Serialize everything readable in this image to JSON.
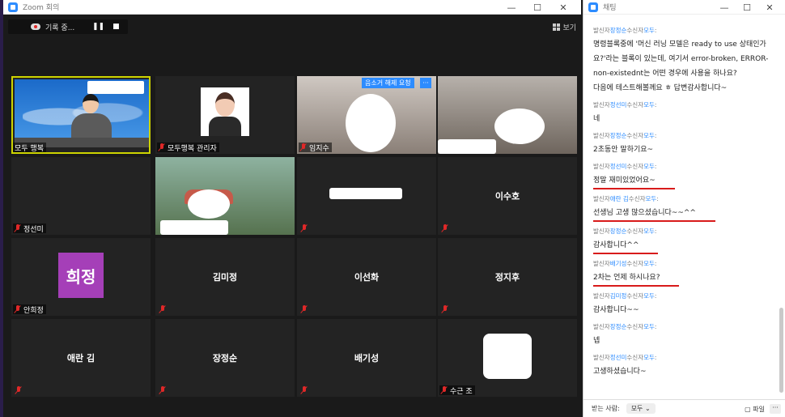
{
  "zoom": {
    "title": "Zoom 회의",
    "recording_text": "기록 중...",
    "pause_glyph": "❚❚",
    "stop_glyph": "■",
    "view_label": "보기",
    "window_controls": [
      "—",
      "☐",
      "✕"
    ]
  },
  "participants": [
    {
      "name": "모두 행복",
      "type": "video"
    },
    {
      "name": "모두행복 관리자",
      "type": "photo"
    },
    {
      "name": "임지수",
      "type": "video",
      "hint": "음소거 해제 요청",
      "more": "···"
    },
    {
      "name": "",
      "type": "video"
    },
    {
      "name": "정선미",
      "type": "dark"
    },
    {
      "name": "",
      "type": "video"
    },
    {
      "name": "",
      "type": "dark"
    },
    {
      "name": "이수호",
      "type": "dark"
    },
    {
      "name": "안희정",
      "type": "avatar",
      "avatar": "희정"
    },
    {
      "name": "김미정",
      "type": "dark"
    },
    {
      "name": "이선화",
      "type": "dark"
    },
    {
      "name": "정지후",
      "type": "dark"
    },
    {
      "name": "애란 김",
      "type": "dark"
    },
    {
      "name": "장정순",
      "type": "dark"
    },
    {
      "name": "배기성",
      "type": "dark"
    },
    {
      "name": "수근 조",
      "type": "dark"
    }
  ],
  "chat": {
    "title": "채팅",
    "window_controls": [
      "—",
      "☐",
      "✕"
    ],
    "messages": [
      {
        "from": "장정순",
        "to": "모두",
        "text": "명령블록중에 '머신 러닝 모델은 ready to use 상태인가요?'라는 블록이 있는데, 여기서 error-broken, ERROR-non-existednt는 어떤 경우에 사용을 하나요?\n다음에 테스트해볼께요 ㅎ 답변감사합니다~"
      },
      {
        "from": "정선미",
        "to": "모두",
        "text": "네"
      },
      {
        "from": "장정순",
        "to": "모두",
        "text": "2초동안 말하기요~"
      },
      {
        "from": "정선미",
        "to": "모두",
        "text": "정말 재미있었어요~",
        "underline": true
      },
      {
        "from": "애란 김",
        "to": "모두",
        "text": "선생님 고생 많으셨습니다~~^^",
        "underline": true
      },
      {
        "from": "장정순",
        "to": "모두",
        "text": "감사합니다^^",
        "underline": true
      },
      {
        "from": "배기성",
        "to": "모두",
        "text": "2차는 언제 하시나요?",
        "underline": true
      },
      {
        "from": "김미정",
        "to": "모두",
        "text": "감사합니다~~"
      },
      {
        "from": "장정순",
        "to": "모두",
        "text": "넵"
      },
      {
        "from": "정선미",
        "to": "모두",
        "text": "고생하셨습니다~"
      }
    ],
    "sender_prefix": "발신자",
    "receiver_prefix": "수신자",
    "footer": {
      "to_label": "받는 사람:",
      "to_value": "모두 ⌄",
      "file_label": "파일",
      "more": "···"
    }
  }
}
